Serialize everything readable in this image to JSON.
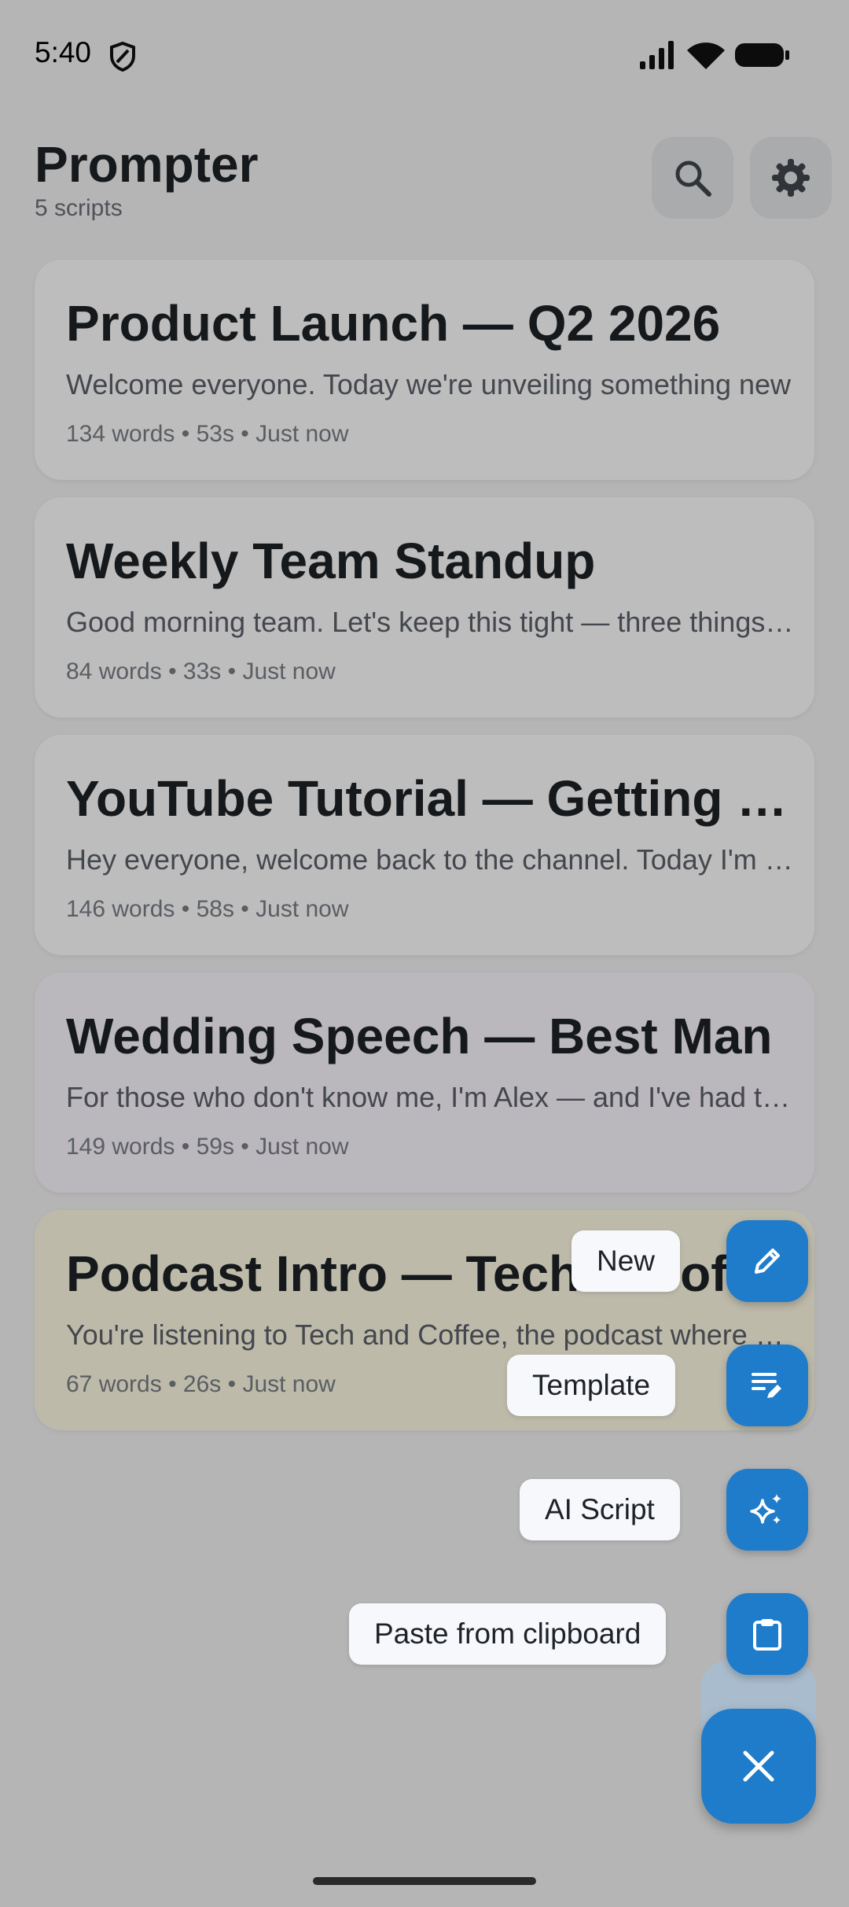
{
  "status_bar": {
    "time": "5:40",
    "icons": [
      "shield-icon",
      "signal-icon",
      "wifi-icon",
      "battery-icon"
    ]
  },
  "header": {
    "title": "Prompter",
    "subtitle": "5 scripts",
    "actions": [
      "search-icon",
      "gear-icon"
    ]
  },
  "scripts": [
    {
      "title": "Product Launch — Q2 2026",
      "preview": "Welcome everyone. Today we're unveiling something new",
      "meta": "134 words • 53s • Just now"
    },
    {
      "title": "Weekly Team Standup",
      "preview": "Good morning team. Let's keep this tight — three things today",
      "meta": "84 words • 33s • Just now"
    },
    {
      "title": "YouTube Tutorial — Getting Started",
      "preview": "Hey everyone, welcome back to the channel. Today I'm going to show you",
      "meta": "146 words • 58s • Just now"
    },
    {
      "title": "Wedding Speech — Best Man",
      "preview": "For those who don't know me, I'm Alex — and I've had the honor",
      "meta": "149 words • 59s • Just now"
    },
    {
      "title": "Podcast Intro — Tech & Coffee",
      "preview": "You're listening to Tech and Coffee, the podcast where we talk",
      "meta": "67 words • 26s • Just now"
    }
  ],
  "speed_dial": {
    "items": [
      {
        "label": "New",
        "icon": "pencil-icon"
      },
      {
        "label": "Template",
        "icon": "template-icon"
      },
      {
        "label": "AI Script",
        "icon": "sparkles-icon"
      },
      {
        "label": "Paste from clipboard",
        "icon": "clipboard-icon"
      }
    ],
    "close_icon": "close-icon"
  },
  "colors": {
    "accent": "#1f7ccb",
    "background": "#f4f4f6",
    "card": "#ffffff",
    "card_highlight": "#fffbe6",
    "scrim": "rgba(0,0,0,0.26)"
  }
}
